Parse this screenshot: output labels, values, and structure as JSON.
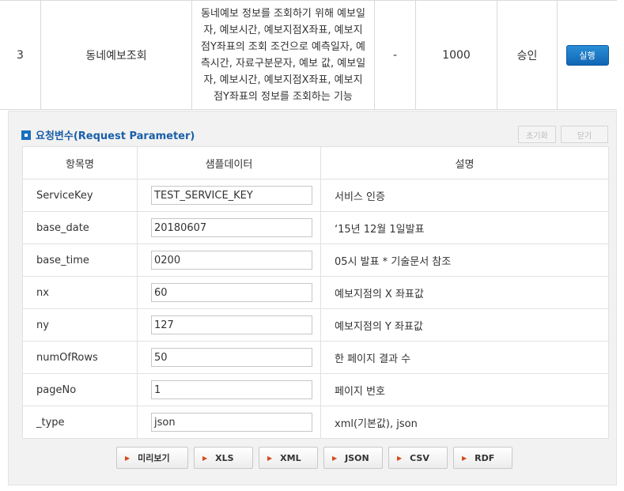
{
  "api_row": {
    "no": "3",
    "name": "동네예보조회",
    "description_lines": [
      "동네예보 정보를 조회하기 위해 예보일",
      "자, 예보시간, 예보지점X좌표, 예보지",
      "점Y좌표의 조회 조건으로 예측일자, 예",
      "측시간, 자료구분문자, 예보 값, 예보일",
      "자, 예보시간, 예보지점X좌표, 예보지",
      "점Y좌표의 정보를 조회하는 기능"
    ],
    "dash": "-",
    "count": "1000",
    "status": "승인",
    "exec_label": "실행"
  },
  "panel": {
    "title": "요청변수(Request Parameter)",
    "reset_label": "초기화",
    "close_label": "닫기",
    "headers": [
      "항목명",
      "샘플데이터",
      "설명"
    ],
    "params": [
      {
        "name": "ServiceKey",
        "value": "TEST_SERVICE_KEY",
        "desc": "서비스 인증"
      },
      {
        "name": "base_date",
        "value": "20180607",
        "desc": "‘15년 12월 1일발표"
      },
      {
        "name": "base_time",
        "value": "0200",
        "desc": "05시 발표 * 기술문서 참조"
      },
      {
        "name": "nx",
        "value": "60",
        "desc": "예보지점의 X 좌표값"
      },
      {
        "name": "ny",
        "value": "127",
        "desc": "예보지점의 Y 좌표값"
      },
      {
        "name": "numOfRows",
        "value": "50",
        "desc": "한 페이지 결과 수"
      },
      {
        "name": "pageNo",
        "value": "1",
        "desc": "페이지 번호"
      },
      {
        "name": "_type",
        "value": "json",
        "desc": "xml(기본값), json"
      }
    ],
    "format_buttons": [
      "미리보기",
      "XLS",
      "XML",
      "JSON",
      "CSV",
      "RDF"
    ]
  }
}
